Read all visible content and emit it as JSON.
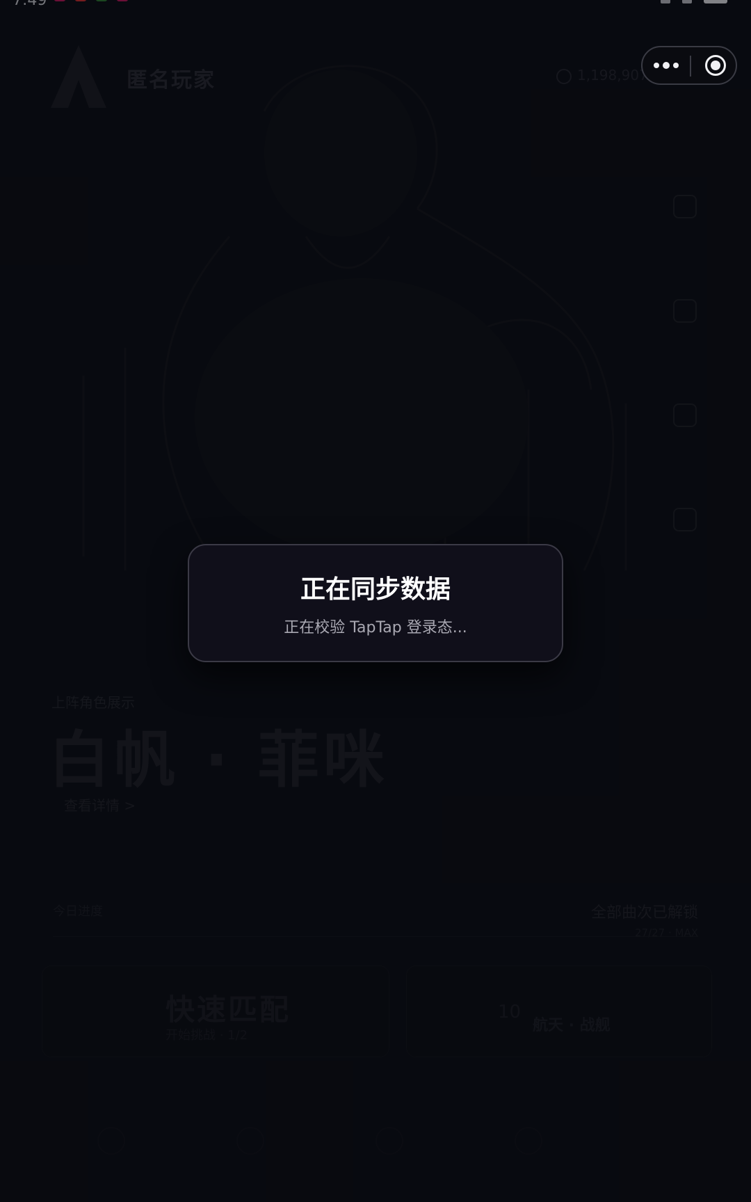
{
  "status_bar": {
    "time": "7:49"
  },
  "header": {
    "app_title": "匿名玩家",
    "coin_readout": "1,198,907"
  },
  "capsule": {
    "more_icon": "ellipsis-icon",
    "close_icon": "target-circle-icon"
  },
  "character": {
    "subtitle": "上阵角色展示",
    "name": "白帆 · 菲咪",
    "details_link": "查看详情 >"
  },
  "progress_row": {
    "left_label": "今日进度",
    "right_title": "全部曲次已解锁",
    "right_sub": "27/27 · MAX"
  },
  "cards": {
    "left_title": "快速匹配",
    "left_sub": "开始挑战 · 1/2",
    "right_number": "10",
    "right_label": "航天 · 战舰"
  },
  "modal": {
    "title": "正在同步数据",
    "message": "正在校验 TapTap 登录态..."
  },
  "colors": {
    "background": "#0c0d14",
    "modal_bg": "#100f1a",
    "modal_border": "#3b3a46",
    "modal_text": "#a9a8b2"
  }
}
